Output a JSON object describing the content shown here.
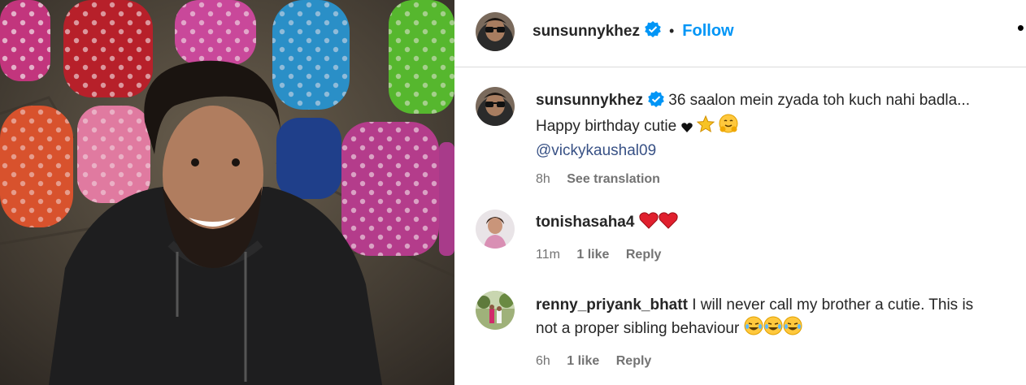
{
  "post": {
    "author": "sunsunnykhez",
    "follow_label": "Follow",
    "separator": "•",
    "more_label": "•"
  },
  "comments": [
    {
      "username": "sunsunnykhez",
      "line1": "36 saalon mein zyada toh kuch nahi badla...",
      "line2": "Happy birthday cutie",
      "mention": "@vickykaushal09",
      "time": "8h",
      "action": "See translation"
    },
    {
      "username": "tonishasaha4",
      "time": "11m",
      "likes": "1 like",
      "reply": "Reply"
    },
    {
      "username": "renny_priyank_bhatt",
      "line1": "I will never call my brother a cutie. This is",
      "line2": "not a proper sibling behaviour",
      "time": "6h",
      "likes": "1 like",
      "reply": "Reply"
    }
  ],
  "colors": {
    "accent": "#0095f6",
    "verified": "#0095f6",
    "mention": "#385185",
    "secondary_text": "#737373"
  }
}
